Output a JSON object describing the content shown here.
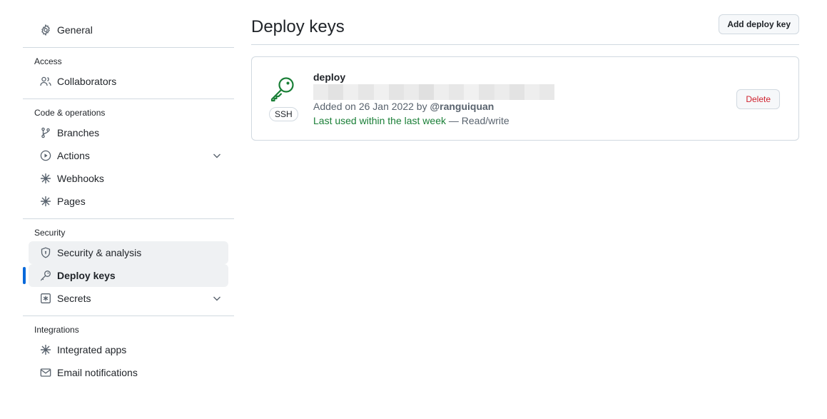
{
  "sidebar": {
    "general": "General",
    "access_label": "Access",
    "collaborators": "Collaborators",
    "code_label": "Code & operations",
    "branches": "Branches",
    "actions": "Actions",
    "webhooks": "Webhooks",
    "pages": "Pages",
    "security_label": "Security",
    "security_analysis": "Security & analysis",
    "deploy_keys": "Deploy keys",
    "secrets": "Secrets",
    "integrations_label": "Integrations",
    "integrated_apps": "Integrated apps",
    "email_notifications": "Email notifications"
  },
  "main": {
    "title": "Deploy keys",
    "add_button": "Add deploy key",
    "key": {
      "name": "deploy",
      "type_badge": "SSH",
      "added_prefix": "Added on 26 Jan 2022 by ",
      "added_by": "@ranguiquan",
      "last_used": "Last used within the last week",
      "access": " — Read/write",
      "delete_label": "Delete"
    }
  },
  "colors": {
    "accent": "#0969da",
    "success": "#1a7f37",
    "danger": "#cf222e"
  }
}
